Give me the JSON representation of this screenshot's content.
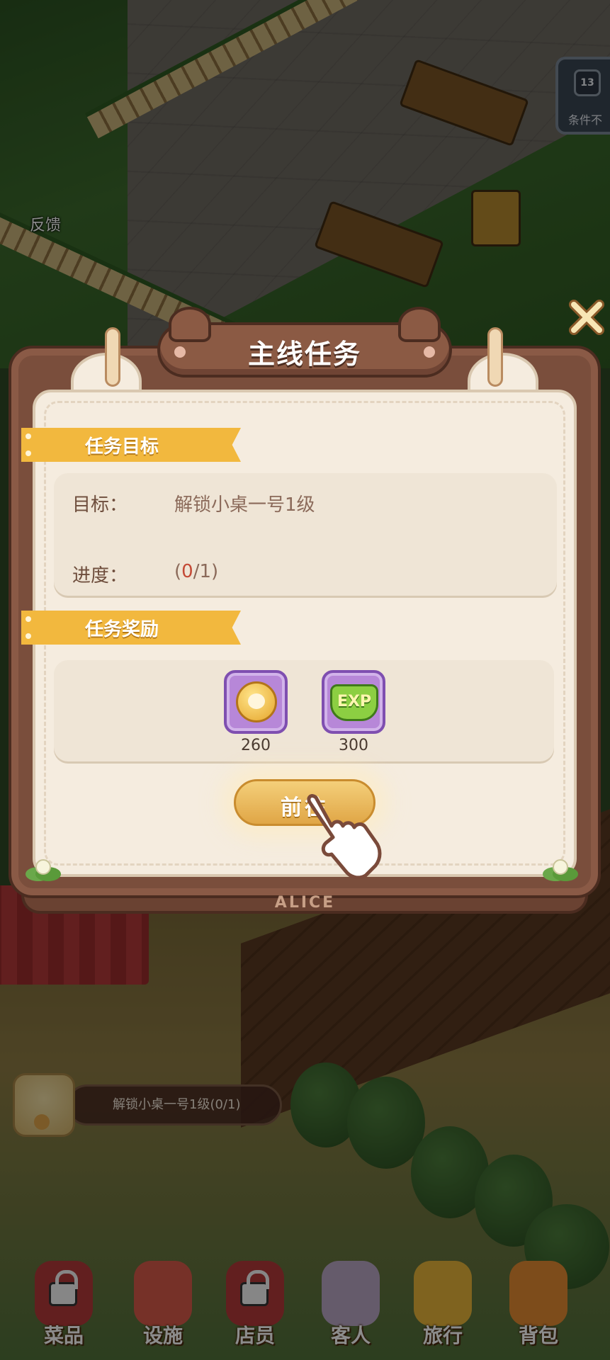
{
  "hud": {
    "feedback_label": "反馈",
    "level_number": "13",
    "level_condition": "条件不",
    "quest_tracker_text": "解锁小桌一号1级(0/1)"
  },
  "dialog": {
    "title": "主线任务",
    "objective_section": "任务目标",
    "objective_label": "目标：",
    "objective_value": "解锁小桌一号1级",
    "progress_label": "进度：",
    "progress_open": "(",
    "progress_current": "0",
    "progress_rest": "/1)",
    "reward_section": "任务奖励",
    "rewards": [
      {
        "icon": "paw-coin-icon",
        "amount": "260"
      },
      {
        "icon": "exp-icon",
        "amount": "300",
        "icon_text": "EXP"
      }
    ],
    "go_button": "前往",
    "footer_brand": "ALICE"
  },
  "bottom_nav": [
    {
      "label": "菜品",
      "icon": "dishes-icon",
      "locked": true
    },
    {
      "label": "设施",
      "icon": "facilities-icon",
      "locked": false
    },
    {
      "label": "店员",
      "icon": "staff-icon",
      "locked": true
    },
    {
      "label": "客人",
      "icon": "guests-icon",
      "locked": false
    },
    {
      "label": "旅行",
      "icon": "travel-icon",
      "locked": false
    },
    {
      "label": "背包",
      "icon": "backpack-icon",
      "locked": false
    }
  ],
  "colors": {
    "board_brown": "#7a4e3c",
    "paper": "#f5ecdf",
    "ribbon": "#f2b83e",
    "reward_frame": "#b787d8",
    "progress_red": "#c44a36"
  }
}
